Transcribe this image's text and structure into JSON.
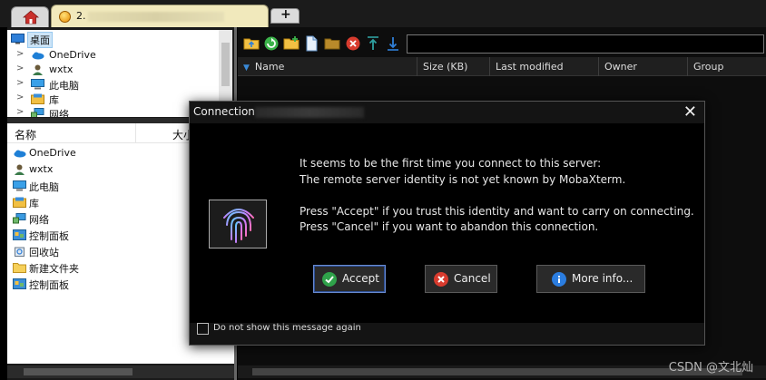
{
  "tabs": {
    "home_icon": "home-icon",
    "session_label": "2.",
    "new_tab_label": "+"
  },
  "left_tree": {
    "items": [
      {
        "label": "桌面",
        "icon": "desktop-icon"
      },
      {
        "label": "OneDrive",
        "icon": "cloud-icon"
      },
      {
        "label": "wxtx",
        "icon": "user-icon"
      },
      {
        "label": "此电脑",
        "icon": "computer-icon"
      },
      {
        "label": "库",
        "icon": "library-icon"
      },
      {
        "label": "网络",
        "icon": "network-icon"
      }
    ]
  },
  "left_list": {
    "col_name": "名称",
    "col_size": "大小",
    "items": [
      {
        "label": "OneDrive",
        "icon": "cloud-icon"
      },
      {
        "label": "wxtx",
        "icon": "user-icon"
      },
      {
        "label": "此电脑",
        "icon": "computer-icon"
      },
      {
        "label": "库",
        "icon": "library-icon"
      },
      {
        "label": "网络",
        "icon": "network-icon"
      },
      {
        "label": "控制面板",
        "icon": "control-panel-icon"
      },
      {
        "label": "回收站",
        "icon": "recycle-bin-icon"
      },
      {
        "label": "新建文件夹",
        "icon": "folder-icon"
      },
      {
        "label": "控制面板",
        "icon": "control-panel-icon"
      }
    ]
  },
  "sftp": {
    "path_value": "",
    "columns": [
      "Name",
      "Size (KB)",
      "Last modified",
      "Owner",
      "Group"
    ]
  },
  "dialog": {
    "title": "Connection",
    "message_lines": [
      "It seems to be the first time you connect to this server:",
      "The remote server identity is not yet known by MobaXterm.",
      "Press \"Accept\" if you trust this identity and want to carry on connecting.",
      "Press \"Cancel\" if you want to abandon this connection."
    ],
    "accept_label": "Accept",
    "cancel_label": "Cancel",
    "more_info_label": "More info...",
    "checkbox_label": "Do not show this message again"
  },
  "watermark": "CSDN @文北灿",
  "colors": {
    "accept": "#2fa24a",
    "cancel": "#d83b2e",
    "info": "#2b7de0"
  }
}
